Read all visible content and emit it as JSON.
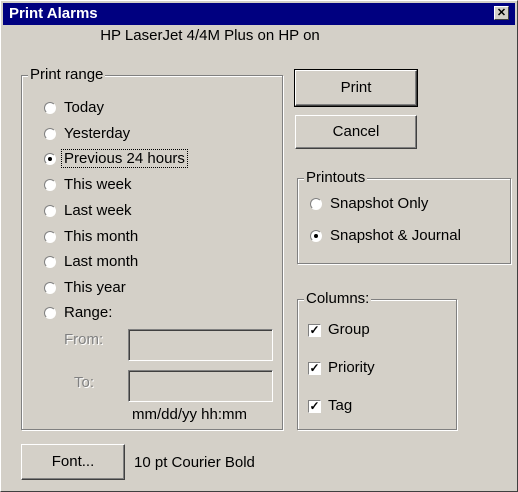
{
  "window": {
    "title": "Print Alarms",
    "close_symbol": "✕"
  },
  "printer": "HP LaserJet 4/4M Plus on HP on",
  "print_range": {
    "label": "Print range",
    "options": [
      {
        "label": "Today",
        "selected": false
      },
      {
        "label": "Yesterday",
        "selected": false
      },
      {
        "label": "Previous 24 hours",
        "selected": true
      },
      {
        "label": "This week",
        "selected": false
      },
      {
        "label": "Last week",
        "selected": false
      },
      {
        "label": "This month",
        "selected": false
      },
      {
        "label": "Last month",
        "selected": false
      },
      {
        "label": "This year",
        "selected": false
      },
      {
        "label": "Range:",
        "selected": false
      }
    ],
    "from_label": "From:",
    "from_value": "",
    "to_label": "To:",
    "to_value": "",
    "format_hint": "mm/dd/yy hh:mm"
  },
  "buttons": {
    "print": "Print",
    "cancel": "Cancel",
    "font": "Font..."
  },
  "printouts": {
    "label": "Printouts",
    "options": [
      {
        "label": "Snapshot Only",
        "selected": false
      },
      {
        "label": "Snapshot & Journal",
        "selected": true
      }
    ]
  },
  "columns": {
    "label": "Columns:",
    "items": [
      {
        "label": "Group",
        "checked": true
      },
      {
        "label": "Priority",
        "checked": true
      },
      {
        "label": "Tag",
        "checked": true
      }
    ]
  },
  "font_description": "10 pt Courier Bold"
}
